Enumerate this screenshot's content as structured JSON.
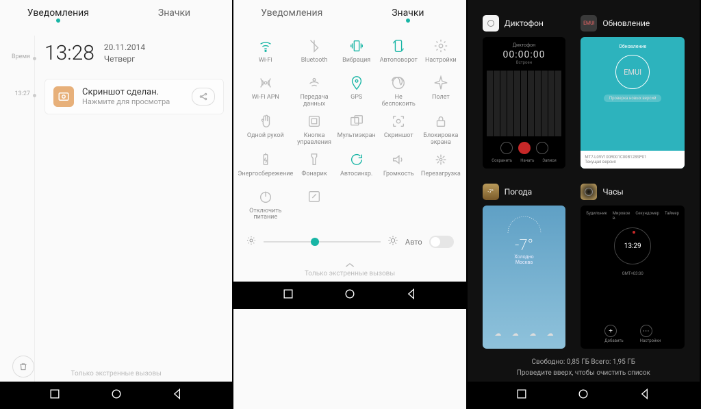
{
  "phone1": {
    "tabs": [
      "Уведомления",
      "Значки"
    ],
    "activeTab": 0,
    "timeline": {
      "label0": "Время",
      "label1": "13:27"
    },
    "clock": "13:28",
    "date": "20.11.2014",
    "weekday": "Четверг",
    "notif": {
      "title": "Скриншот сделан.",
      "sub": "Нажмите для просмотра"
    },
    "emergency": "Только экстренные вызовы"
  },
  "phone2": {
    "tabs": [
      "Уведомления",
      "Значки"
    ],
    "activeTab": 1,
    "toggles": [
      {
        "name": "wifi",
        "label": "Wi-Fi",
        "active": true
      },
      {
        "name": "bluetooth",
        "label": "Bluetooth",
        "active": false
      },
      {
        "name": "vibration",
        "label": "Вибрация",
        "active": true
      },
      {
        "name": "autorotate",
        "label": "Автоповорот",
        "active": true
      },
      {
        "name": "settings",
        "label": "Настройки",
        "active": false
      },
      {
        "name": "wifi-apn",
        "label": "Wi-Fi APN",
        "active": false
      },
      {
        "name": "data",
        "label": "Передача данных",
        "active": false
      },
      {
        "name": "gps",
        "label": "GPS",
        "active": true
      },
      {
        "name": "dnd",
        "label": "Не беспокоить",
        "active": false
      },
      {
        "name": "airplane",
        "label": "Полет",
        "active": false
      },
      {
        "name": "onehand",
        "label": "Одной рукой",
        "active": false
      },
      {
        "name": "control-btn",
        "label": "Кнопка управления",
        "active": false
      },
      {
        "name": "multiscreen",
        "label": "Мультиэкран",
        "active": false
      },
      {
        "name": "screenshot",
        "label": "Скриншот",
        "active": false
      },
      {
        "name": "screen-lock",
        "label": "Блокировка экрана",
        "active": false
      },
      {
        "name": "power-save",
        "label": "Энергосбережение",
        "active": false
      },
      {
        "name": "flashlight",
        "label": "Фонарик",
        "active": false
      },
      {
        "name": "autosync",
        "label": "Автосинхр.",
        "active": true
      },
      {
        "name": "volume",
        "label": "Громкость",
        "active": false
      },
      {
        "name": "reboot",
        "label": "Перезагрузка",
        "active": false
      },
      {
        "name": "power-off",
        "label": "Отключить питание",
        "active": false
      },
      {
        "name": "edit",
        "label": "",
        "active": false
      }
    ],
    "brightness": {
      "percent": 40,
      "autoLabel": "Авто",
      "autoOn": false
    },
    "emergency": "Только экстренные вызовы"
  },
  "phone3": {
    "cards": {
      "dictaphone": {
        "title": "Диктофон",
        "header": "Диктофон",
        "time": "00:00:00",
        "sub": "Встроен",
        "btnLabels": [
          "Сохранить",
          "Начать",
          "Записи"
        ]
      },
      "update": {
        "title": "Обновление",
        "header": "Обновление",
        "logo": "EMUI",
        "banner": "Проверка новых версий",
        "foot1": "MT7-L09V100R001C00B128SP01",
        "foot2": "Текущая версия"
      },
      "weather": {
        "title": "Погода",
        "city": "Москва",
        "temp": "-7°",
        "cond": "Холодно"
      },
      "clock": {
        "title": "Часы",
        "tabs": [
          "Будильник",
          "Мировое в.",
          "Секундомер",
          "Таймер"
        ],
        "time": "13:29",
        "tz": "GMT+03:00",
        "btnLabels": [
          "Добавить",
          "Настройки"
        ]
      }
    },
    "footer": {
      "memory": "Свободно: 0,85 ГБ Всего: 1,95 ГБ",
      "hint": "Проведите вверх, чтобы очистить список"
    }
  }
}
